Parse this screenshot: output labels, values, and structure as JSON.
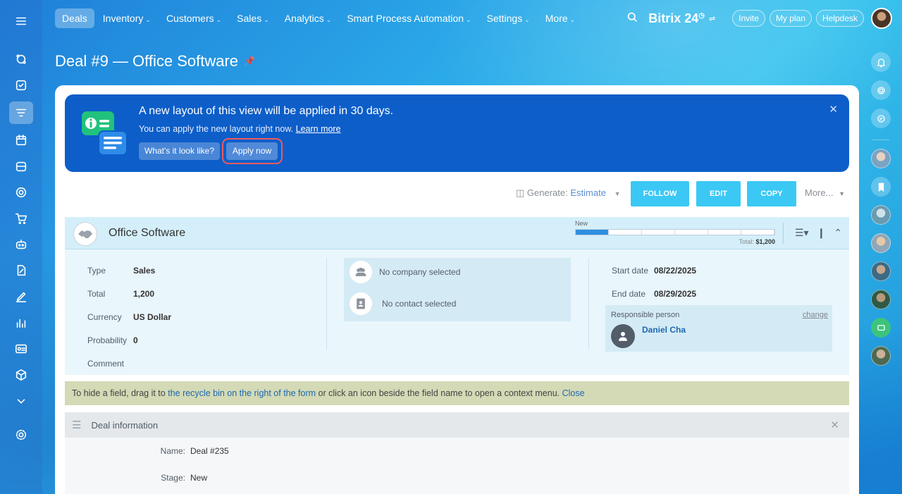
{
  "top_nav": {
    "items": [
      {
        "label": "Deals",
        "active": true,
        "has_menu": false
      },
      {
        "label": "Inventory",
        "has_menu": true
      },
      {
        "label": "Customers",
        "has_menu": true
      },
      {
        "label": "Sales",
        "has_menu": true
      },
      {
        "label": "Analytics",
        "has_menu": true
      },
      {
        "label": "Smart Process Automation",
        "has_menu": true
      },
      {
        "label": "Settings",
        "has_menu": true
      },
      {
        "label": "More",
        "has_menu": true
      }
    ],
    "brand": "Bitrix 24",
    "invite": "Invite",
    "my_plan": "My plan",
    "helpdesk": "Helpdesk"
  },
  "page": {
    "title": "Deal #9 — Office Software"
  },
  "banner": {
    "heading": "A new layout of this view will be applied in 30 days.",
    "text": "You can apply the new layout right now.",
    "learn_more": "Learn more",
    "preview_button": "What's it look like?",
    "apply_button": "Apply now"
  },
  "toolbar": {
    "generate_label": "Generate:",
    "generate_value": "Estimate",
    "follow": "FOLLOW",
    "edit": "EDIT",
    "copy": "COPY",
    "more": "More..."
  },
  "deal": {
    "name": "Office Software",
    "stage_label": "New",
    "stage_progress_segments": 1,
    "stage_total_segments": 6,
    "total_label": "Total:",
    "total_value": "$1,200"
  },
  "summary_fields": [
    {
      "label": "Type",
      "value": "Sales"
    },
    {
      "label": "Total",
      "value": "1,200"
    },
    {
      "label": "Currency",
      "value": "US Dollar"
    },
    {
      "label": "Probability",
      "value": "0"
    },
    {
      "label": "Comment",
      "value": ""
    }
  ],
  "client": {
    "company": "No company selected",
    "contact": "No contact selected"
  },
  "dates": {
    "start_label": "Start date",
    "start_value": "08/22/2025",
    "end_label": "End date",
    "end_value": "08/29/2025"
  },
  "responsible": {
    "title": "Responsible person",
    "change": "change",
    "name": "Daniel Cha"
  },
  "hint": {
    "text_before": "To hide a field, drag it to",
    "link": "the recycle bin on the right of the form",
    "text_after": "or click an icon beside the field name to open a context menu.",
    "close": "Close"
  },
  "section": {
    "title": "Deal information",
    "rows": [
      {
        "label": "Name:",
        "value": "Deal #235"
      },
      {
        "label": "Stage:",
        "value": "New"
      }
    ]
  },
  "colors": {
    "banner_bg": "#0d5ec9",
    "action_button": "#3bc8f5",
    "highlight_outline": "#ef5b5b",
    "deal_header_bg": "#d4effa",
    "hint_bg": "#d3dab5"
  }
}
